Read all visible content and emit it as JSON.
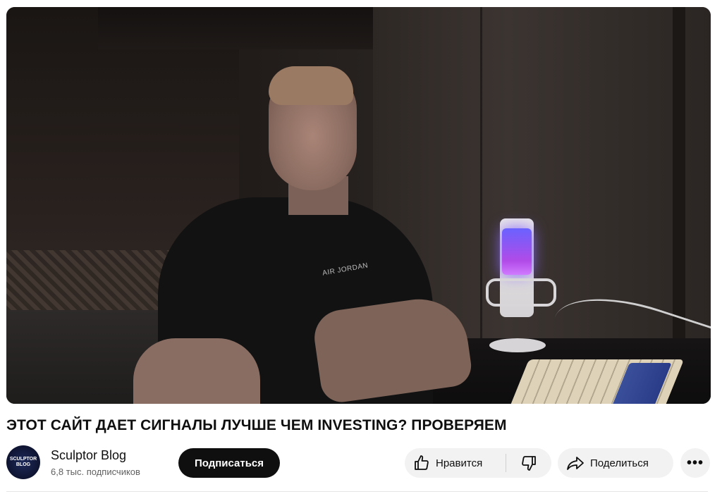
{
  "video": {
    "shirt_text": "AIR JORDAN"
  },
  "title": "ЭТОТ САЙТ ДАЕТ СИГНАЛЫ ЛУЧШЕ ЧЕМ INVESTING? ПРОВЕРЯЕМ",
  "channel": {
    "avatar_text": "SCULPTOR BLOG",
    "name": "Sculptor Blog",
    "subscribers": "6,8 тыс. подписчиков"
  },
  "actions": {
    "subscribe_label": "Подписаться",
    "like_label": "Нравится",
    "share_label": "Поделиться",
    "more_label": "•••"
  },
  "icons": {
    "like": "thumbs-up-icon",
    "dislike": "thumbs-down-icon",
    "share": "share-arrow-icon",
    "more": "more-dots-icon"
  },
  "colors": {
    "subscribe_bg": "#0f0f0f",
    "pill_bg": "#f2f2f2",
    "subtext": "#606060"
  }
}
